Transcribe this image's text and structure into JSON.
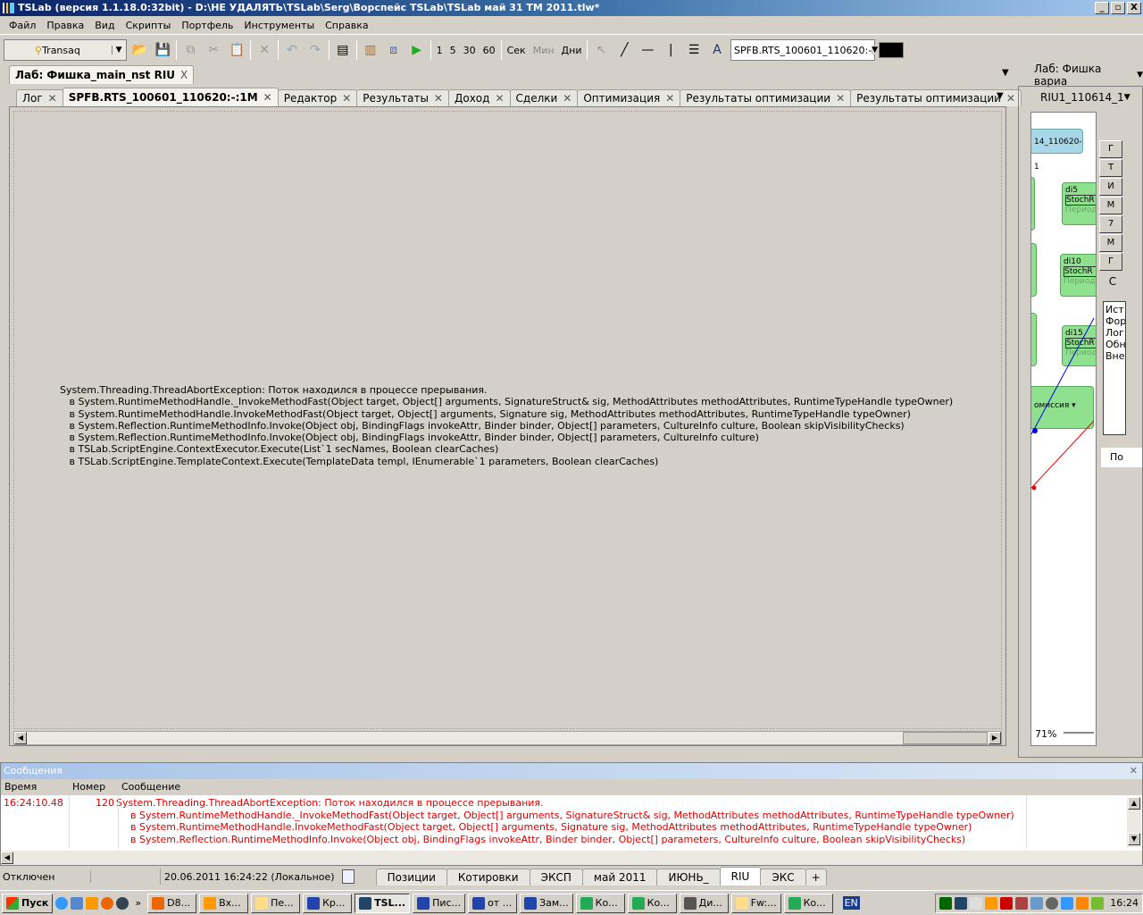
{
  "window": {
    "title": "TSLab (версия 1.1.18.0:32bit) - D:\\НЕ УДАЛЯТЬ\\TSLab\\Serg\\Ворспейс TSLab\\TSLab май  31  TM 2011.tlw*",
    "min": "_",
    "max": "▫",
    "close": "X"
  },
  "menu": [
    "Файл",
    "Правка",
    "Вид",
    "Скрипты",
    "Портфель",
    "Инструменты",
    "Справка"
  ],
  "toolbar": {
    "provider": "Transaq",
    "intervals": [
      "1",
      "5",
      "30",
      "60"
    ],
    "units": [
      "Сек",
      "Мин",
      "Дни"
    ],
    "security": "SPFB.RTS_100601_110620:-"
  },
  "doc_tab": {
    "label": "Лаб: Фишка_main_nst RIU",
    "close": "X"
  },
  "tabs": [
    {
      "label": "Лог"
    },
    {
      "label": "SPFB.RTS_100601_110620:-:1M",
      "active": true
    },
    {
      "label": "Редактор"
    },
    {
      "label": "Результаты"
    },
    {
      "label": "Доход"
    },
    {
      "label": "Сделки"
    },
    {
      "label": "Оптимизация"
    },
    {
      "label": "Результаты оптимизации"
    },
    {
      "label": "Результаты оптимизации"
    }
  ],
  "error_text": "System.Threading.ThreadAbortException: Поток находился в процессе прерывания.\n   в System.RuntimeMethodHandle._InvokeMethodFast(Object target, Object[] arguments, SignatureStruct& sig, MethodAttributes methodAttributes, RuntimeTypeHandle typeOwner)\n   в System.RuntimeMethodHandle.InvokeMethodFast(Object target, Object[] arguments, Signature sig, MethodAttributes methodAttributes, RuntimeTypeHandle typeOwner)\n   в System.Reflection.RuntimeMethodInfo.Invoke(Object obj, BindingFlags invokeAttr, Binder binder, Object[] parameters, CultureInfo culture, Boolean skipVisibilityChecks)\n   в System.Reflection.RuntimeMethodInfo.Invoke(Object obj, BindingFlags invokeAttr, Binder binder, Object[] parameters, CultureInfo culture)\n   в TSLab.ScriptEngine.ContextExecutor.Execute(List`1 secNames, Boolean clearCaches)\n   в TSLab.ScriptEngine.TemplateContext.Execute(TemplateData templ, IEnumerable`1 parameters, Boolean clearCaches)",
  "right_panel": {
    "doc_tab": "Лаб: Фишка вариа",
    "sub_tab": "RIU1_110614_1",
    "source_node": "14_110620-1",
    "nodes": [
      {
        "name": "di5",
        "block": "StochR",
        "param": "Период"
      },
      {
        "name": "di10",
        "block": "StochR",
        "param": "Период"
      },
      {
        "name": "di15",
        "block": "StochR",
        "param": "Период"
      }
    ],
    "commission": "омиссия",
    "side_buttons": [
      "Г",
      "Т",
      "И",
      "М",
      "7",
      "М",
      "Г"
    ],
    "section": "С",
    "list": [
      "Ист",
      "Фор",
      "Лог",
      "Обн",
      "Вне"
    ],
    "bottom_tab": "По",
    "zoom": "71%"
  },
  "messages": {
    "title": "Сообщения",
    "columns": [
      "Время",
      "Номер",
      "Сообщение"
    ],
    "time": "16:24:10.48",
    "number": "120",
    "lines": [
      "System.Threading.ThreadAbortException: Поток находился в процессе прерывания.",
      "    в System.RuntimeMethodHandle._InvokeMethodFast(Object target, Object[] arguments, SignatureStruct& sig, MethodAttributes methodAttributes, RuntimeTypeHandle typeOwner)",
      "    в System.RuntimeMethodHandle.InvokeMethodFast(Object target, Object[] arguments, Signature sig, MethodAttributes methodAttributes, RuntimeTypeHandle typeOwner)",
      "    в System.Reflection.RuntimeMethodInfo.Invoke(Object obj, BindingFlags invokeAttr, Binder binder, Object[] parameters, CultureInfo culture, Boolean skipVisibilityChecks)"
    ]
  },
  "status": {
    "connection": "Отключен",
    "datetime": "20.06.2011 16:24:22 (Локальное)",
    "tabs": [
      "Позиции",
      "Котировки",
      "ЭКСП",
      "май 2011",
      "ИЮНЬ_",
      "RIU",
      "ЭКС"
    ],
    "active_tab": "RIU",
    "add": "+"
  },
  "taskbar": {
    "start": "Пуск",
    "chevron": "»",
    "tasks": [
      "D8...",
      "Вх...",
      "Пе...",
      "Кр...",
      "TSL...",
      "Пис...",
      "от ...",
      "Зам...",
      "Ко...",
      "Ко...",
      "Ди...",
      "Fw:...",
      "Ко..."
    ],
    "lang": "EN",
    "clock": "16:24"
  }
}
